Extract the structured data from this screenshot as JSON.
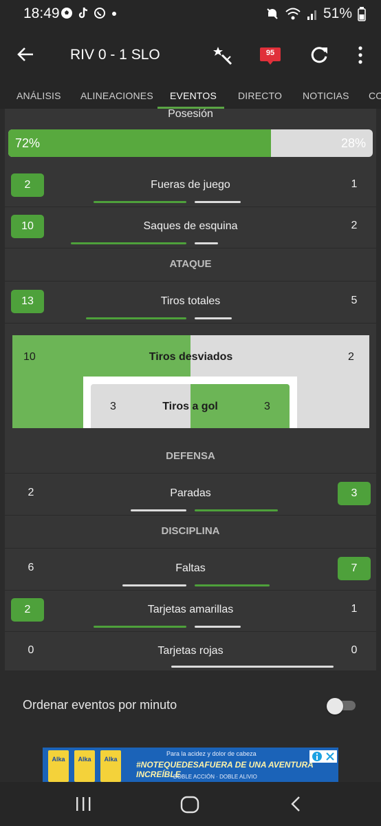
{
  "status_bar": {
    "time": "18:49",
    "battery": "51%",
    "icons": [
      "soccer-ball-icon",
      "tiktok-icon",
      "whatsapp-icon",
      "dot-icon",
      "mute-icon",
      "wifi-icon",
      "signal-icon",
      "battery-icon"
    ]
  },
  "header": {
    "title": "RIV 0 - 1 SLO",
    "notification_badge": "95",
    "icons": [
      "back-arrow-icon",
      "magic-wand-icon",
      "notifications-icon",
      "refresh-icon",
      "more-vert-icon"
    ]
  },
  "tabs": [
    {
      "label": "ANÁLISIS",
      "active": false
    },
    {
      "label": "ALINEACIONES",
      "active": false
    },
    {
      "label": "EVENTOS",
      "active": true
    },
    {
      "label": "DIRECTO",
      "active": false
    },
    {
      "label": "NOTICIAS",
      "active": false
    },
    {
      "label": "CO",
      "active": false
    }
  ],
  "possession": {
    "label": "Posesión",
    "home_text": "72%",
    "away_text": "28%",
    "home_fraction": 0.72
  },
  "stats_top": [
    {
      "label": "Fueras de juego",
      "home": "2",
      "away": "1",
      "leader": "home"
    },
    {
      "label": "Saques de esquina",
      "home": "10",
      "away": "2",
      "leader": "home"
    }
  ],
  "attack": {
    "heading": "ATAQUE",
    "total_shots": {
      "label": "Tiros totales",
      "home": "13",
      "away": "5",
      "leader": "home"
    },
    "shots_off": {
      "label": "Tiros desviados",
      "home": "10",
      "away": "2"
    },
    "shots_on": {
      "label": "Tiros a gol",
      "home": "3",
      "away": "3"
    }
  },
  "defense": {
    "heading": "DEFENSA",
    "saves": {
      "label": "Paradas",
      "home": "2",
      "away": "3",
      "leader": "away"
    }
  },
  "discipline": {
    "heading": "DISCIPLINA",
    "fouls": {
      "label": "Faltas",
      "home": "6",
      "away": "7",
      "leader": "away"
    },
    "yellow": {
      "label": "Tarjetas amarillas",
      "home": "2",
      "away": "1",
      "leader": "home"
    },
    "red": {
      "label": "Tarjetas rojas",
      "home": "0",
      "away": "0",
      "leader": "none"
    }
  },
  "toggle": {
    "label": "Ordenar eventos por minuto",
    "on": false
  },
  "ad": {
    "brand": "Alka",
    "line1": "Para la acidez y dolor de cabeza",
    "line2": "#NOTEQUEDESAFUERA DE UNA AVENTURA INCREÍBLE",
    "line3": "DOBLE ACCIÓN · DOBLE ALIVIO"
  },
  "colors": {
    "accent_green": "#4ea13b",
    "bar_light": "#dcdcdc",
    "card_bg": "#363636",
    "bg": "#2b2b2b",
    "badge_red": "#e0303a"
  }
}
